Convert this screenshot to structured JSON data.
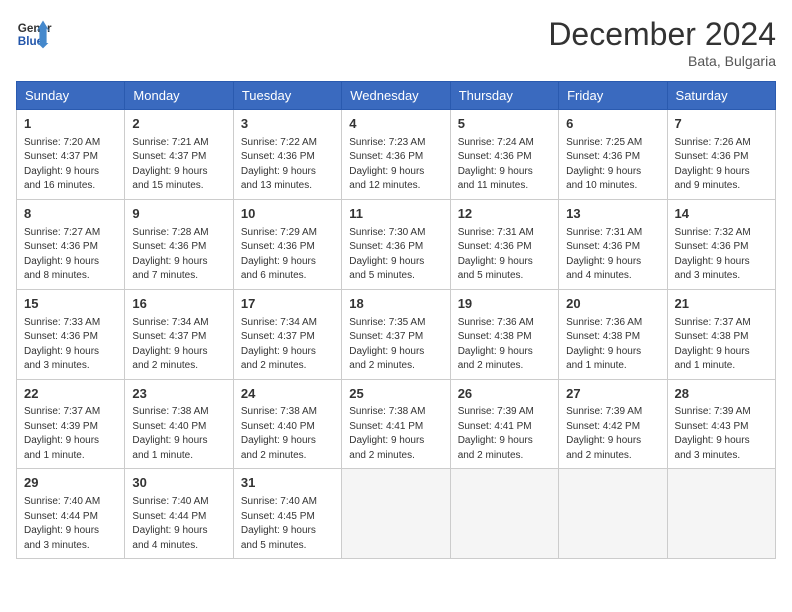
{
  "header": {
    "logo_line1": "General",
    "logo_line2": "Blue",
    "month_title": "December 2024",
    "location": "Bata, Bulgaria"
  },
  "weekdays": [
    "Sunday",
    "Monday",
    "Tuesday",
    "Wednesday",
    "Thursday",
    "Friday",
    "Saturday"
  ],
  "weeks": [
    [
      {
        "day": "1",
        "info": "Sunrise: 7:20 AM\nSunset: 4:37 PM\nDaylight: 9 hours\nand 16 minutes."
      },
      {
        "day": "2",
        "info": "Sunrise: 7:21 AM\nSunset: 4:37 PM\nDaylight: 9 hours\nand 15 minutes."
      },
      {
        "day": "3",
        "info": "Sunrise: 7:22 AM\nSunset: 4:36 PM\nDaylight: 9 hours\nand 13 minutes."
      },
      {
        "day": "4",
        "info": "Sunrise: 7:23 AM\nSunset: 4:36 PM\nDaylight: 9 hours\nand 12 minutes."
      },
      {
        "day": "5",
        "info": "Sunrise: 7:24 AM\nSunset: 4:36 PM\nDaylight: 9 hours\nand 11 minutes."
      },
      {
        "day": "6",
        "info": "Sunrise: 7:25 AM\nSunset: 4:36 PM\nDaylight: 9 hours\nand 10 minutes."
      },
      {
        "day": "7",
        "info": "Sunrise: 7:26 AM\nSunset: 4:36 PM\nDaylight: 9 hours\nand 9 minutes."
      }
    ],
    [
      {
        "day": "8",
        "info": "Sunrise: 7:27 AM\nSunset: 4:36 PM\nDaylight: 9 hours\nand 8 minutes."
      },
      {
        "day": "9",
        "info": "Sunrise: 7:28 AM\nSunset: 4:36 PM\nDaylight: 9 hours\nand 7 minutes."
      },
      {
        "day": "10",
        "info": "Sunrise: 7:29 AM\nSunset: 4:36 PM\nDaylight: 9 hours\nand 6 minutes."
      },
      {
        "day": "11",
        "info": "Sunrise: 7:30 AM\nSunset: 4:36 PM\nDaylight: 9 hours\nand 5 minutes."
      },
      {
        "day": "12",
        "info": "Sunrise: 7:31 AM\nSunset: 4:36 PM\nDaylight: 9 hours\nand 5 minutes."
      },
      {
        "day": "13",
        "info": "Sunrise: 7:31 AM\nSunset: 4:36 PM\nDaylight: 9 hours\nand 4 minutes."
      },
      {
        "day": "14",
        "info": "Sunrise: 7:32 AM\nSunset: 4:36 PM\nDaylight: 9 hours\nand 3 minutes."
      }
    ],
    [
      {
        "day": "15",
        "info": "Sunrise: 7:33 AM\nSunset: 4:36 PM\nDaylight: 9 hours\nand 3 minutes."
      },
      {
        "day": "16",
        "info": "Sunrise: 7:34 AM\nSunset: 4:37 PM\nDaylight: 9 hours\nand 2 minutes."
      },
      {
        "day": "17",
        "info": "Sunrise: 7:34 AM\nSunset: 4:37 PM\nDaylight: 9 hours\nand 2 minutes."
      },
      {
        "day": "18",
        "info": "Sunrise: 7:35 AM\nSunset: 4:37 PM\nDaylight: 9 hours\nand 2 minutes."
      },
      {
        "day": "19",
        "info": "Sunrise: 7:36 AM\nSunset: 4:38 PM\nDaylight: 9 hours\nand 2 minutes."
      },
      {
        "day": "20",
        "info": "Sunrise: 7:36 AM\nSunset: 4:38 PM\nDaylight: 9 hours\nand 1 minute."
      },
      {
        "day": "21",
        "info": "Sunrise: 7:37 AM\nSunset: 4:38 PM\nDaylight: 9 hours\nand 1 minute."
      }
    ],
    [
      {
        "day": "22",
        "info": "Sunrise: 7:37 AM\nSunset: 4:39 PM\nDaylight: 9 hours\nand 1 minute."
      },
      {
        "day": "23",
        "info": "Sunrise: 7:38 AM\nSunset: 4:40 PM\nDaylight: 9 hours\nand 1 minute."
      },
      {
        "day": "24",
        "info": "Sunrise: 7:38 AM\nSunset: 4:40 PM\nDaylight: 9 hours\nand 2 minutes."
      },
      {
        "day": "25",
        "info": "Sunrise: 7:38 AM\nSunset: 4:41 PM\nDaylight: 9 hours\nand 2 minutes."
      },
      {
        "day": "26",
        "info": "Sunrise: 7:39 AM\nSunset: 4:41 PM\nDaylight: 9 hours\nand 2 minutes."
      },
      {
        "day": "27",
        "info": "Sunrise: 7:39 AM\nSunset: 4:42 PM\nDaylight: 9 hours\nand 2 minutes."
      },
      {
        "day": "28",
        "info": "Sunrise: 7:39 AM\nSunset: 4:43 PM\nDaylight: 9 hours\nand 3 minutes."
      }
    ],
    [
      {
        "day": "29",
        "info": "Sunrise: 7:40 AM\nSunset: 4:44 PM\nDaylight: 9 hours\nand 3 minutes."
      },
      {
        "day": "30",
        "info": "Sunrise: 7:40 AM\nSunset: 4:44 PM\nDaylight: 9 hours\nand 4 minutes."
      },
      {
        "day": "31",
        "info": "Sunrise: 7:40 AM\nSunset: 4:45 PM\nDaylight: 9 hours\nand 5 minutes."
      },
      null,
      null,
      null,
      null
    ]
  ]
}
